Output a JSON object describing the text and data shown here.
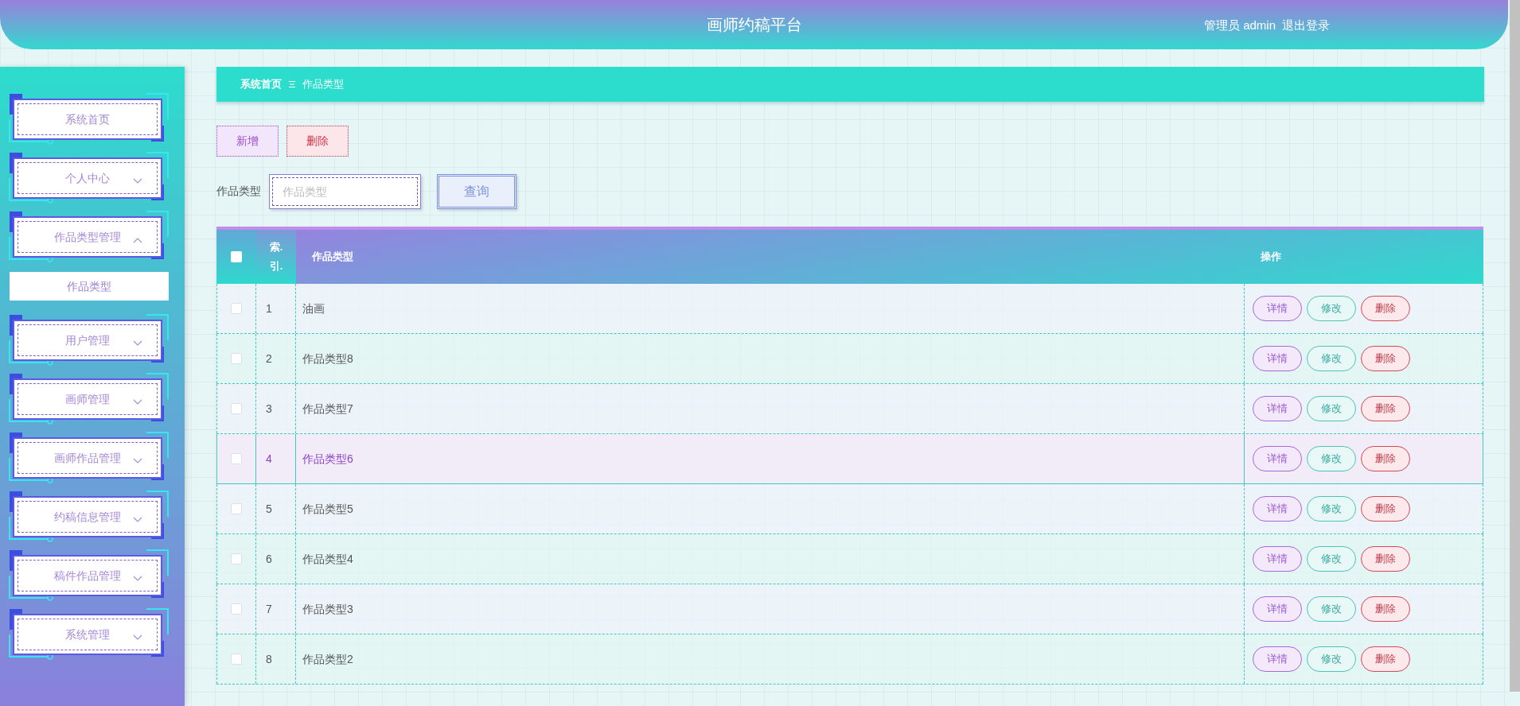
{
  "header": {
    "title": "画师约稿平台",
    "user": "管理员 admin",
    "logout": "退出登录"
  },
  "sidebar": {
    "items": [
      {
        "label": "系统首页",
        "kind": "link"
      },
      {
        "label": "个人中心",
        "kind": "group",
        "expanded": false
      },
      {
        "label": "作品类型管理",
        "kind": "group",
        "expanded": true,
        "children": [
          {
            "label": "作品类型",
            "selected": true
          }
        ]
      },
      {
        "label": "用户管理",
        "kind": "group",
        "expanded": false
      },
      {
        "label": "画师管理",
        "kind": "group",
        "expanded": false
      },
      {
        "label": "画师作品管理",
        "kind": "group",
        "expanded": false
      },
      {
        "label": "约稿信息管理",
        "kind": "group",
        "expanded": false
      },
      {
        "label": "稿件作品管理",
        "kind": "group",
        "expanded": false
      },
      {
        "label": "系统管理",
        "kind": "group",
        "expanded": false
      }
    ]
  },
  "breadcrumb": [
    "系统首页",
    "作品类型"
  ],
  "actions": [
    {
      "label": "新增",
      "kind": "add"
    },
    {
      "label": "删除",
      "kind": "delete"
    }
  ],
  "search": {
    "label": "作品类型",
    "placeholder": "作品类型",
    "button": "查询"
  },
  "table": {
    "all_checked": false,
    "columns": [
      "索.引.",
      "作品类型",
      "操作"
    ],
    "rows": [
      {
        "index": "1",
        "type": "油画",
        "checked": false,
        "selected": false,
        "actions": [
          {
            "label": "详情",
            "kind": "detail"
          },
          {
            "label": "修改",
            "kind": "edit"
          },
          {
            "label": "删除",
            "kind": "delete"
          }
        ]
      },
      {
        "index": "2",
        "type": "作品类型8",
        "checked": false,
        "selected": false,
        "actions": [
          {
            "label": "详情",
            "kind": "detail"
          },
          {
            "label": "修改",
            "kind": "edit"
          },
          {
            "label": "删除",
            "kind": "delete"
          }
        ]
      },
      {
        "index": "3",
        "type": "作品类型7",
        "checked": false,
        "selected": false,
        "actions": [
          {
            "label": "详情",
            "kind": "detail"
          },
          {
            "label": "修改",
            "kind": "edit"
          },
          {
            "label": "删除",
            "kind": "delete"
          }
        ]
      },
      {
        "index": "4",
        "type": "作品类型6",
        "checked": false,
        "selected": true,
        "actions": [
          {
            "label": "详情",
            "kind": "detail"
          },
          {
            "label": "修改",
            "kind": "edit"
          },
          {
            "label": "删除",
            "kind": "delete"
          }
        ]
      },
      {
        "index": "5",
        "type": "作品类型5",
        "checked": false,
        "selected": false,
        "actions": [
          {
            "label": "详情",
            "kind": "detail"
          },
          {
            "label": "修改",
            "kind": "edit"
          },
          {
            "label": "删除",
            "kind": "delete"
          }
        ]
      },
      {
        "index": "6",
        "type": "作品类型4",
        "checked": false,
        "selected": false,
        "actions": [
          {
            "label": "详情",
            "kind": "detail"
          },
          {
            "label": "修改",
            "kind": "edit"
          },
          {
            "label": "删除",
            "kind": "delete"
          }
        ]
      },
      {
        "index": "7",
        "type": "作品类型3",
        "checked": false,
        "selected": false,
        "actions": [
          {
            "label": "详情",
            "kind": "detail"
          },
          {
            "label": "修改",
            "kind": "edit"
          },
          {
            "label": "删除",
            "kind": "delete"
          }
        ]
      },
      {
        "index": "8",
        "type": "作品类型2",
        "checked": false,
        "selected": false,
        "actions": [
          {
            "label": "详情",
            "kind": "detail"
          },
          {
            "label": "修改",
            "kind": "edit"
          },
          {
            "label": "删除",
            "kind": "delete"
          }
        ]
      }
    ]
  }
}
